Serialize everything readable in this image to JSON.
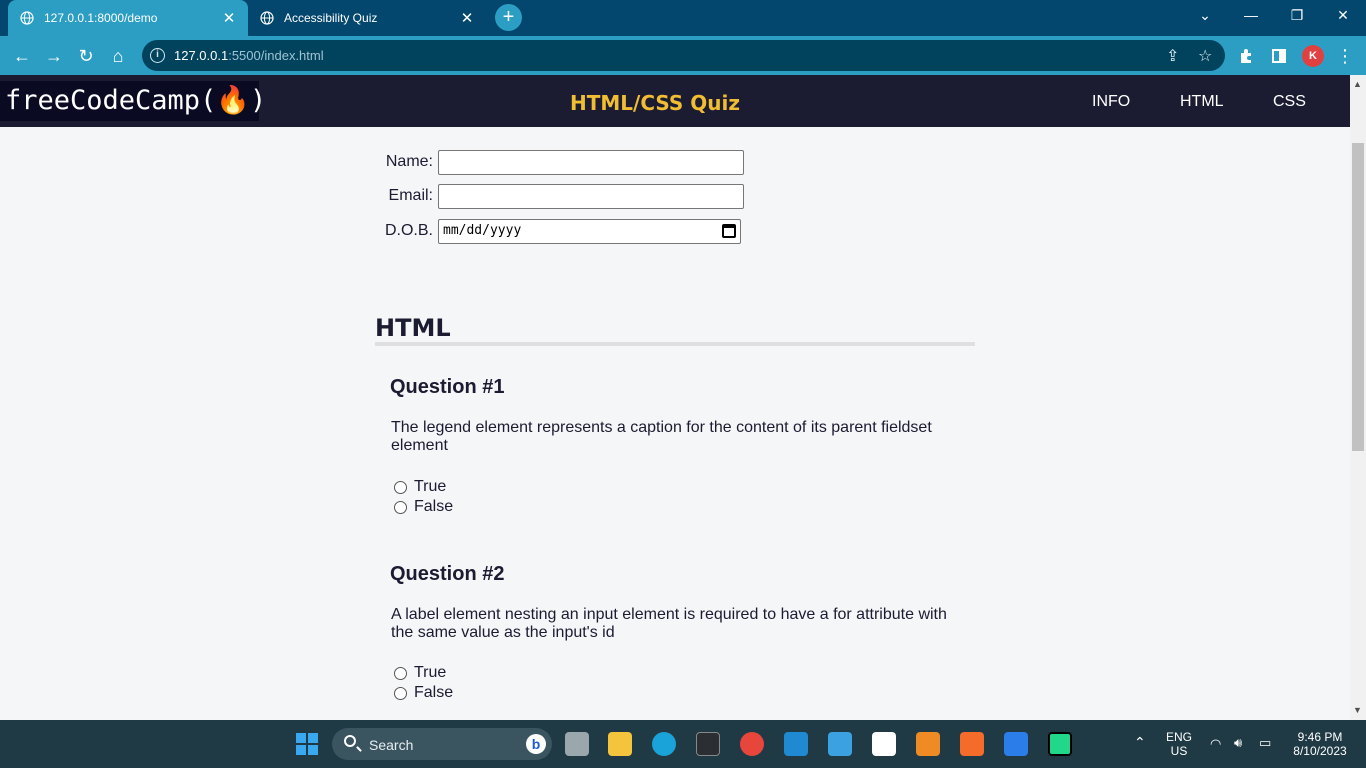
{
  "browser": {
    "tabs": [
      {
        "title": "127.0.0.1:8000/demo",
        "close": "✕"
      },
      {
        "title": "Accessibility Quiz",
        "close": "✕"
      }
    ],
    "new_tab": "+",
    "window_controls": {
      "collapse": "⌄",
      "minimize": "—",
      "restore": "❐",
      "close": "✕"
    },
    "nav": {
      "back": "←",
      "forward": "→",
      "reload": "↻",
      "home": "⌂"
    },
    "address": {
      "host": "127.0.0.1",
      "path": ":5500/index.html"
    },
    "profile_initial": "K",
    "menu": "⋮"
  },
  "header": {
    "logo": "freeCodeCamp(🔥)",
    "title": "HTML/CSS Quiz",
    "nav": [
      "INFO",
      "HTML",
      "CSS"
    ]
  },
  "form": {
    "name_label": "Name:",
    "email_label": "Email:",
    "dob_label": "D.O.B.",
    "dob_placeholder": "mm/dd/yyyy"
  },
  "section": {
    "title": "HTML",
    "questions": [
      {
        "title": "Question #1",
        "text": "The legend element represents a caption for the content of its parent fieldset element",
        "options": [
          "True",
          "False"
        ]
      },
      {
        "title": "Question #2",
        "text": "A label element nesting an input element is required to have a for attribute with the same value as the input's id",
        "options": [
          "True",
          "False"
        ]
      }
    ]
  },
  "taskbar": {
    "search_label": "Search",
    "language": "ENG",
    "region": "US",
    "time": "9:46 PM",
    "date": "8/10/2023"
  },
  "colors": {
    "header_bg": "#1b1b32",
    "title_color": "#f1be32",
    "chrome_tab": "#2c9ec4",
    "chrome_frame": "#03476e"
  }
}
